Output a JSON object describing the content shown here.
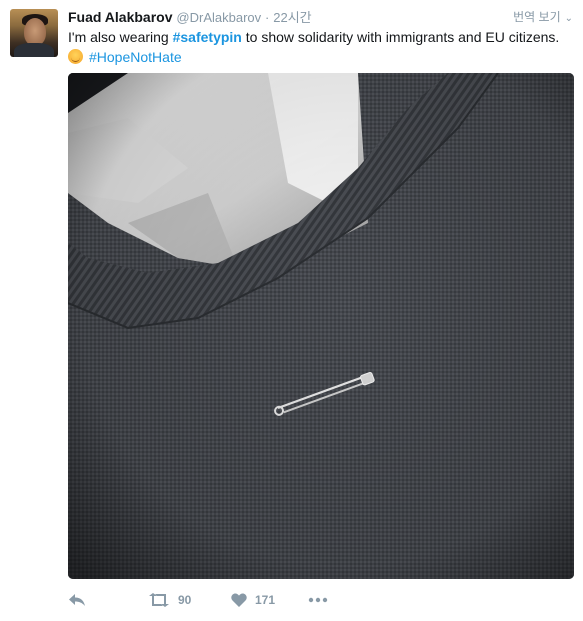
{
  "tweet": {
    "fullname": "Fuad Alakbarov",
    "username": "@DrAlakbarov",
    "separator": "·",
    "time": "22시간",
    "translate_label": "번역 보기",
    "text_before": "I'm also wearing ",
    "hashtag1": "#safetypin",
    "text_after": " to show solidarity with immigrants and EU citizens.",
    "hashtag2": "#HopeNotHate"
  },
  "actions": {
    "reply_icon": "reply-icon",
    "retweet_icon": "retweet-icon",
    "retweet_count": "90",
    "like_icon": "heart-icon",
    "like_count": "171",
    "more_icon": "more-icon"
  },
  "colors": {
    "link": "#1b95e0",
    "meta": "#8899a6",
    "text": "#14171a"
  }
}
